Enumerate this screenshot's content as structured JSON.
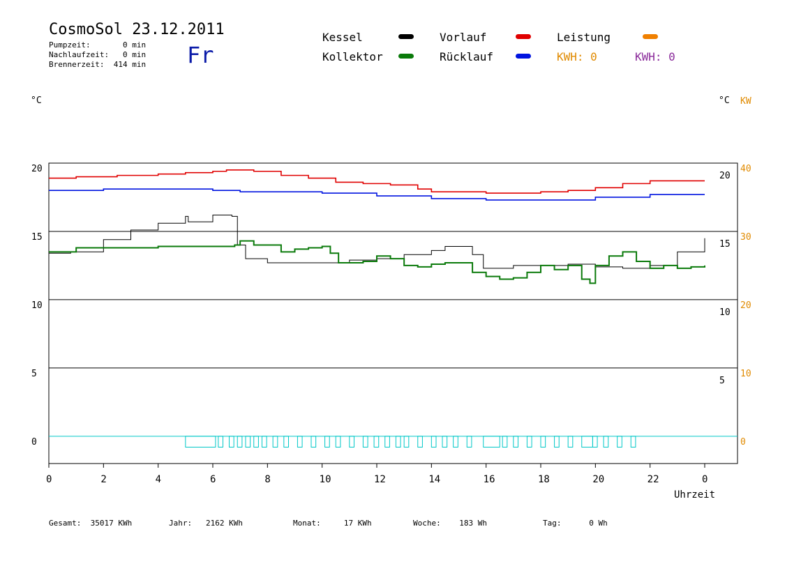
{
  "header": {
    "title": "CosmoSol 23.12.2011",
    "pumpzeit": "Pumpzeit:       0 min",
    "nachlaufzeit": "Nachlaufzeit:   0 min",
    "brennerzeit": "Brennerzeit:  414 min",
    "weekday": "Fr"
  },
  "legend": {
    "kessel": {
      "label": "Kessel",
      "color": "#000000"
    },
    "kollektor": {
      "label": "Kollektor",
      "color": "#0a7a0a"
    },
    "vorlauf": {
      "label": "Vorlauf",
      "color": "#e00000"
    },
    "ruecklauf": {
      "label": "Rücklauf",
      "color": "#0014e0"
    },
    "leistung": {
      "label": "Leistung",
      "color": "#f08000"
    },
    "kwh_orange": "KWH: 0",
    "kwh_purple": "KWH: 0"
  },
  "footer": {
    "gesamt": "Gesamt:  35017 KWh",
    "jahr": "Jahr:   2162 KWh",
    "monat": "Monat:     17 KWh",
    "woche": "Woche:    183 Wh",
    "tag": "Tag:      0 Wh"
  },
  "chart_data": {
    "type": "line",
    "xlabel": "Uhrzeit",
    "ylabel_left": "°C",
    "ylabel_right": "°C",
    "ylabel_right2": "KW",
    "xlim": [
      0,
      24
    ],
    "ylim": [
      -2,
      20
    ],
    "x_ticks": [
      "0",
      "2",
      "4",
      "6",
      "8",
      "10",
      "12",
      "14",
      "16",
      "18",
      "20",
      "22",
      "0"
    ],
    "y_ticks_left": [
      "20",
      "15",
      "10",
      "5",
      "0"
    ],
    "y_ticks_right": [
      "20",
      "15",
      "10",
      "5"
    ],
    "y_ticks_right_kw": [
      "40",
      "30",
      "20",
      "10",
      "0"
    ],
    "grid": true,
    "series": [
      {
        "name": "Vorlauf",
        "color": "#e00000",
        "x": [
          0,
          1,
          2.5,
          4,
          5,
          6,
          6.5,
          7.5,
          8.5,
          9.5,
          10.5,
          11.5,
          12.5,
          13.5,
          14,
          15,
          16,
          17,
          18,
          19,
          20,
          21,
          22,
          23,
          24
        ],
        "y": [
          18.9,
          19.0,
          19.1,
          19.2,
          19.3,
          19.4,
          19.5,
          19.4,
          19.1,
          18.9,
          18.6,
          18.5,
          18.4,
          18.1,
          17.9,
          17.9,
          17.8,
          17.8,
          17.9,
          18.0,
          18.2,
          18.5,
          18.7,
          18.7,
          18.7
        ]
      },
      {
        "name": "Rücklauf",
        "color": "#0014e0",
        "x": [
          0,
          2,
          4,
          6,
          7,
          8,
          10,
          12,
          14,
          16,
          18,
          20,
          22,
          24
        ],
        "y": [
          18.0,
          18.1,
          18.1,
          18.0,
          17.9,
          17.9,
          17.8,
          17.6,
          17.4,
          17.3,
          17.3,
          17.5,
          17.7,
          17.7
        ]
      },
      {
        "name": "Kessel",
        "color": "#000000",
        "x": [
          0,
          0.8,
          2,
          3,
          4,
          5,
          5.1,
          6,
          6.7,
          6.9,
          7.2,
          8,
          9,
          10,
          11,
          12,
          13,
          14,
          14.5,
          15.5,
          15.9,
          16.2,
          17,
          18,
          19,
          20,
          21,
          22,
          23,
          24
        ],
        "y": [
          13.4,
          13.5,
          14.4,
          15.1,
          15.6,
          16.1,
          15.7,
          16.2,
          16.1,
          14.0,
          13.0,
          12.7,
          12.7,
          12.7,
          12.9,
          13.0,
          13.3,
          13.6,
          13.9,
          13.3,
          12.3,
          12.3,
          12.5,
          12.5,
          12.6,
          12.4,
          12.3,
          12.5,
          13.5,
          14.5
        ]
      },
      {
        "name": "Kollektor",
        "color": "#0a7a0a",
        "x": [
          0,
          1,
          2,
          3,
          4,
          5,
          6,
          6.8,
          7,
          7.5,
          8,
          8.5,
          9,
          9.5,
          10,
          10.3,
          10.6,
          11,
          11.5,
          12,
          12.5,
          13,
          13.5,
          14,
          14.5,
          15,
          15.5,
          16,
          16.5,
          17,
          17.5,
          18,
          18.5,
          19,
          19.5,
          19.8,
          20,
          20.5,
          21,
          21.5,
          22,
          22.5,
          23,
          23.5,
          24
        ],
        "y": [
          13.5,
          13.8,
          13.8,
          13.8,
          13.9,
          13.9,
          13.9,
          14.0,
          14.3,
          14.0,
          14.0,
          13.5,
          13.7,
          13.8,
          13.9,
          13.4,
          12.7,
          12.7,
          12.8,
          13.2,
          13.0,
          12.5,
          12.4,
          12.6,
          12.7,
          12.7,
          12.0,
          11.7,
          11.5,
          11.6,
          12.0,
          12.5,
          12.2,
          12.5,
          11.5,
          11.2,
          12.5,
          13.2,
          13.5,
          12.8,
          12.3,
          12.5,
          12.3,
          12.4,
          12.5
        ]
      }
    ]
  }
}
